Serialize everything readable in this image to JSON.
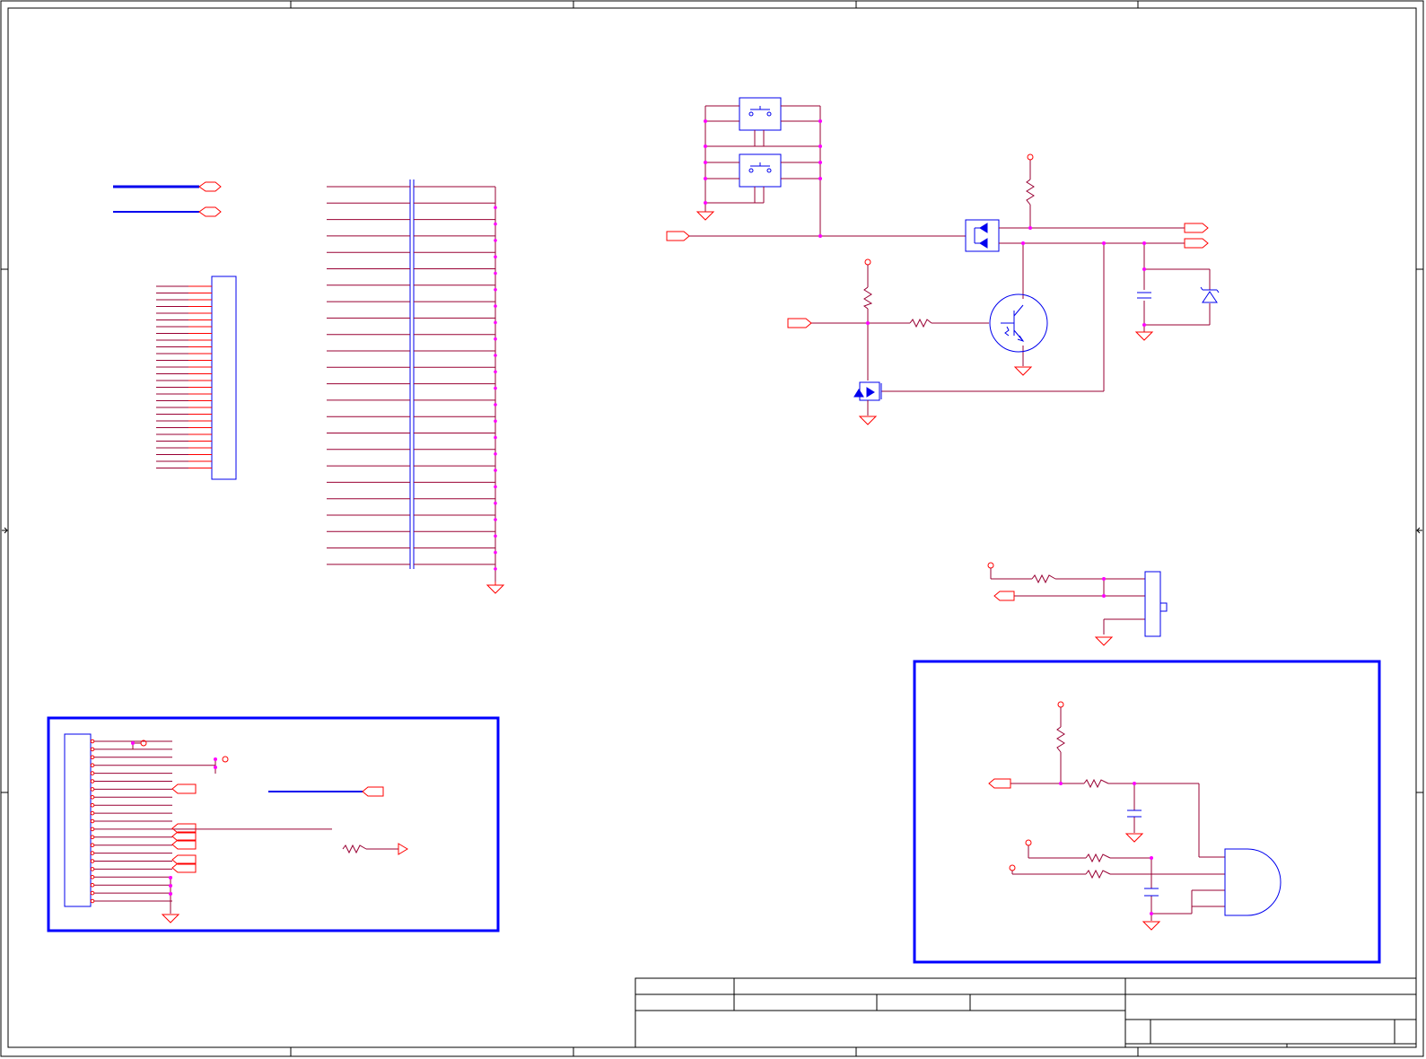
{
  "colors": {
    "background": "#ffffff",
    "frame": "#000000",
    "wire": "#990033",
    "symbol": "#0000ee",
    "net": "#ff0000",
    "junction": "#ff00ff",
    "hierarchy_box": "#0000ff"
  },
  "icons": [
    "push-switch-icon",
    "ground-icon",
    "power-pin-icon",
    "resistor-icon",
    "capacitor-icon",
    "diode-icon",
    "zener-diode-icon",
    "npn-transistor-icon",
    "mosfet-icon",
    "and-gate-icon",
    "connector-icon",
    "net-port-icon"
  ],
  "sheet": {
    "title_block": [
      "",
      "",
      "",
      "",
      "",
      "",
      "",
      ""
    ]
  }
}
